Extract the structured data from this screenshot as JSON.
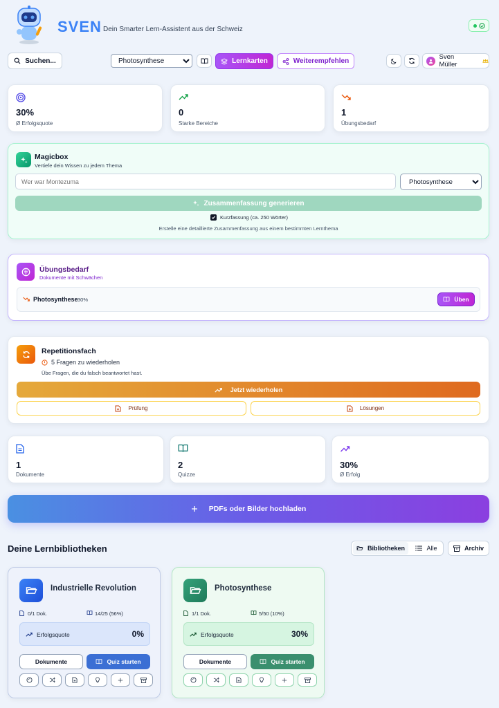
{
  "header": {
    "brand": "SVEN",
    "tagline": "Dein Smarter Lern-Assistent aus der Schweiz"
  },
  "toolbar": {
    "search_label": "Suchen...",
    "topic_select": "Photosynthese",
    "topic_options": [
      "Photosynthese",
      "Industrielle Revolution"
    ],
    "flashcards_label": "Lernkarten",
    "recommend_label": "Weiterempfehlen",
    "user_name": "Sven Müller"
  },
  "stats": [
    {
      "value": "30%",
      "label": "Ø Erfolgsquote",
      "color": "#4f46e5"
    },
    {
      "value": "0",
      "label": "Starke Bereiche",
      "color": "#16a34a"
    },
    {
      "value": "1",
      "label": "Übungsbedarf",
      "color": "#ea580c"
    }
  ],
  "magicbox": {
    "title": "Magicbox",
    "subtitle": "Vertiefe dein Wissen zu jedem Thema",
    "input_placeholder": "Wer war Montezuma",
    "topic_select": "Photosynthese",
    "generate_label": "Zusammenfassung generieren",
    "checkbox_label": "Kurzfassung (ca. 250 Wörter)",
    "checkbox_checked": true,
    "hint": "Erstelle eine detaillierte Zusammenfassung aus einem bestimmten Lernthema"
  },
  "practice": {
    "title": "Übungsbedarf",
    "subtitle": "Dokumente mit Schwächen",
    "item_name": "Photosynthese",
    "item_score": "30%",
    "practice_label": "Üben"
  },
  "repetition": {
    "title": "Repetitionsfach",
    "count_text": "5 Fragen zu wiederholen",
    "description": "Übe Fragen, die du falsch beantwortet hast.",
    "repeat_label": "Jetzt wiederholen",
    "exam_label": "Prüfung",
    "solutions_label": "Lösungen"
  },
  "overview": [
    {
      "value": "1",
      "label": "Dokumente",
      "color": "#2563eb"
    },
    {
      "value": "2",
      "label": "Quizze",
      "color": "#0f766e"
    },
    {
      "value": "30%",
      "label": "Ø Erfolg",
      "color": "#7c3aed"
    }
  ],
  "upload": {
    "label": "PDFs oder Bilder hochladen"
  },
  "libraries": {
    "heading": "Deine Lernbibliotheken",
    "tab_libraries": "Bibliotheken",
    "tab_all": "Alle",
    "archive_label": "Archiv",
    "items": [
      {
        "title": "Industrielle Revolution",
        "docs": "0/1 Dok.",
        "questions": "14/25 (56%)",
        "rate_label": "Erfolgsquote",
        "rate": "0%",
        "docs_button": "Dokumente",
        "quiz_button": "Quiz starten"
      },
      {
        "title": "Photosynthese",
        "docs": "1/1 Dok.",
        "questions": "5/50 (10%)",
        "rate_label": "Erfolgsquote",
        "rate": "30%",
        "docs_button": "Dokumente",
        "quiz_button": "Quiz starten"
      }
    ]
  }
}
